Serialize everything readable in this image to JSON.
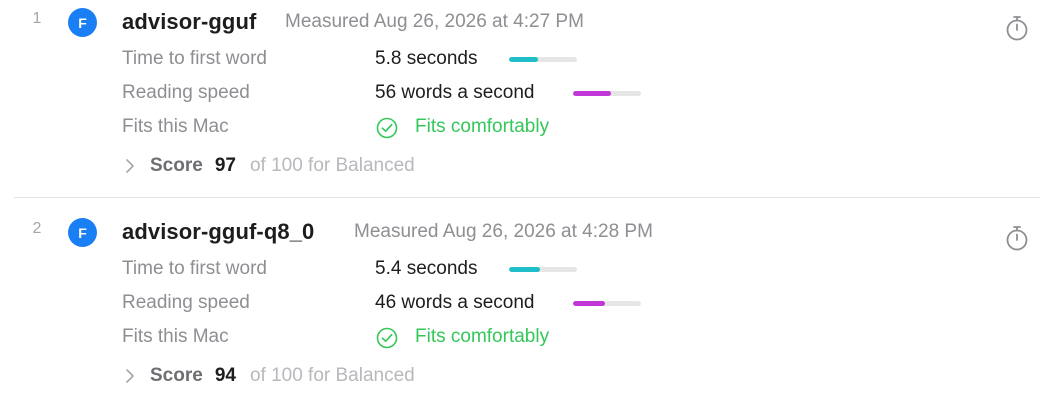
{
  "results": [
    {
      "rank": "1",
      "badge": "F",
      "model": "advisor-gguf",
      "measured": "Measured Aug 26, 2026 at 4:27 PM",
      "time_to_first_word": {
        "label": "Time to first word",
        "value": "5.8 seconds",
        "bar_fraction": 0.43,
        "bar_color": "#1fbec8"
      },
      "reading_speed": {
        "label": "Reading speed",
        "value": "56 words a second",
        "bar_fraction": 0.56,
        "bar_color": "#c136d6"
      },
      "fits": {
        "label": "Fits this Mac",
        "value": "Fits comfortably",
        "color": "#34c759"
      },
      "score": {
        "label": "Score",
        "value": "97",
        "suffix": "of 100 for Balanced"
      },
      "icons": {
        "badge": "model-format-badge",
        "timer": "stopwatch-icon",
        "fits": "checkmark-circle-icon",
        "expand": "chevron-right-icon"
      }
    },
    {
      "rank": "2",
      "badge": "F",
      "model": "advisor-gguf-q8_0",
      "measured": "Measured Aug 26, 2026 at 4:28 PM",
      "time_to_first_word": {
        "label": "Time to first word",
        "value": "5.4 seconds",
        "bar_fraction": 0.46,
        "bar_color": "#1fbec8"
      },
      "reading_speed": {
        "label": "Reading speed",
        "value": "46 words a second",
        "bar_fraction": 0.47,
        "bar_color": "#c136d6"
      },
      "fits": {
        "label": "Fits this Mac",
        "value": "Fits comfortably",
        "color": "#34c759"
      },
      "score": {
        "label": "Score",
        "value": "94",
        "suffix": "of 100 for Balanced"
      },
      "icons": {
        "badge": "model-format-badge",
        "timer": "stopwatch-icon",
        "fits": "checkmark-circle-icon",
        "expand": "chevron-right-icon"
      }
    }
  ]
}
